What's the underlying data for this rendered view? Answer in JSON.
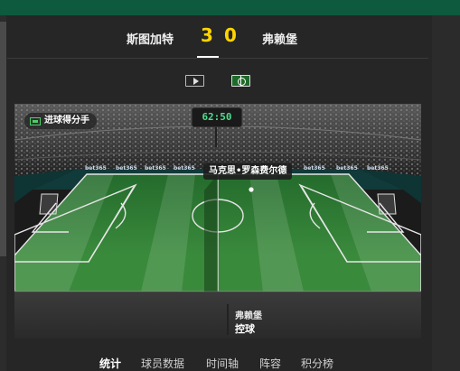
{
  "scoreboard": {
    "home_team": "斯图加特",
    "away_team": "弗赖堡",
    "home_score": "3",
    "away_score": "0"
  },
  "view_toggle": {
    "video_icon": "play-video-icon",
    "pitch_icon": "pitch-view-icon"
  },
  "match_view": {
    "event_badge": "进球得分手",
    "clock": "62:50",
    "player_name": "马克思•罗森费尔德",
    "possession_team": "弗赖堡",
    "possession_label": "控球",
    "advert_text": "bet365"
  },
  "tabs": [
    {
      "label": "统计",
      "active": true
    },
    {
      "label": "球员数据",
      "active": false
    },
    {
      "label": "时间轴",
      "active": false
    },
    {
      "label": "阵容",
      "active": false
    },
    {
      "label": "积分榜",
      "active": false
    }
  ],
  "colors": {
    "score": "#ffd400",
    "clock": "#4ddd8d",
    "top_bar": "#0e5a3e",
    "pitch": "#2f7a35"
  }
}
